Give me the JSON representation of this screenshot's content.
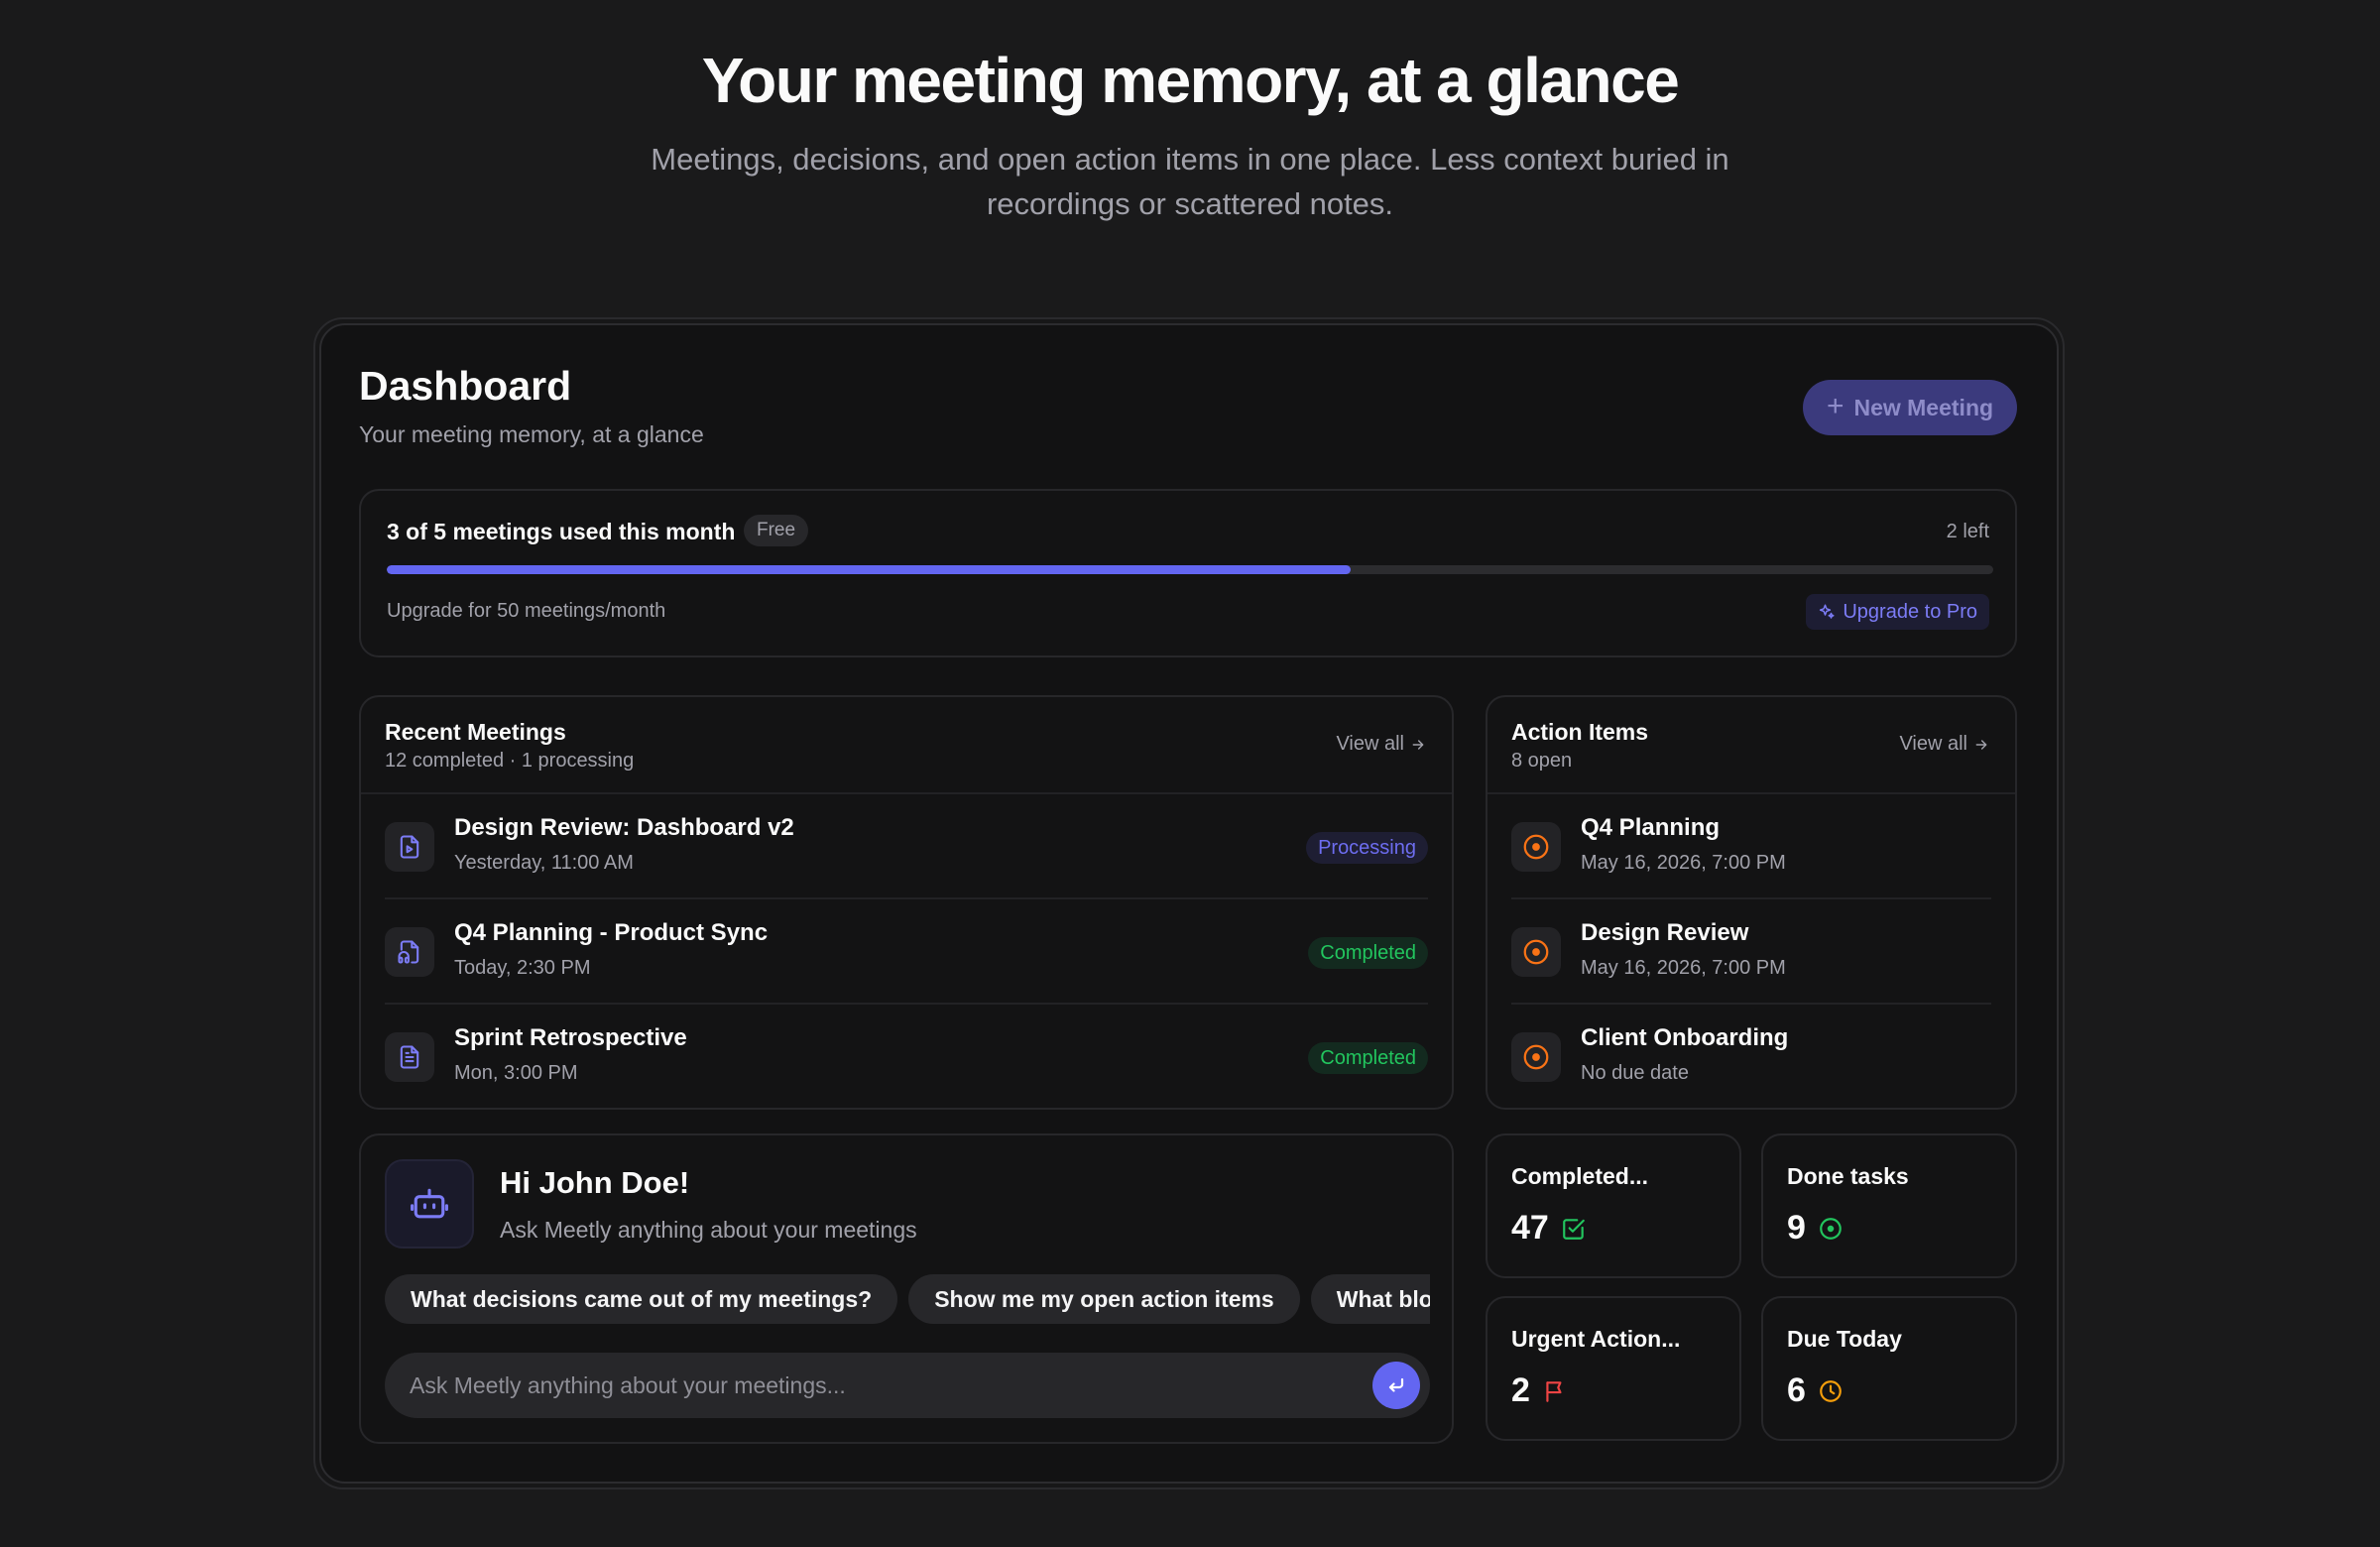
{
  "hero": {
    "title": "Your meeting memory, at a glance",
    "subtitle": "Meetings, decisions, and open action items in one place. Less context buried in recordings or scattered notes."
  },
  "dashboard": {
    "title": "Dashboard",
    "subtitle": "Your meeting memory, at a glance",
    "new_meeting_label": "New Meeting"
  },
  "usage": {
    "title": "3 of 5 meetings used this month",
    "plan_badge": "Free",
    "remaining": "2 left",
    "progress_fraction": 0.6,
    "upgrade_text": "Upgrade for 50 meetings/month",
    "upgrade_button": "Upgrade to Pro"
  },
  "recent_meetings": {
    "title": "Recent Meetings",
    "subtitle": "12 completed · 1 processing",
    "view_all": "View all",
    "items": [
      {
        "title": "Design Review: Dashboard v2",
        "date": "Yesterday, 11:00 AM",
        "status": "Processing",
        "icon": "video-file-icon"
      },
      {
        "title": "Q4 Planning - Product Sync",
        "date": "Today, 2:30 PM",
        "status": "Completed",
        "icon": "audio-file-icon"
      },
      {
        "title": "Sprint Retrospective",
        "date": "Mon, 3:00 PM",
        "status": "Completed",
        "icon": "text-file-icon"
      }
    ]
  },
  "action_items": {
    "title": "Action Items",
    "subtitle": "8 open",
    "view_all": "View all",
    "items": [
      {
        "title": "Q4 Planning",
        "date": "May 16, 2026, 7:00 PM",
        "icon": "target-icon"
      },
      {
        "title": "Design Review",
        "date": "May 16, 2026, 7:00 PM",
        "icon": "target-icon"
      },
      {
        "title": "Client Onboarding",
        "date": "No due date",
        "icon": "target-icon"
      }
    ]
  },
  "assistant": {
    "greeting": "Hi John Doe!",
    "subtitle": "Ask Meetly anything about your meetings",
    "chips": [
      "What decisions came out of my meetings?",
      "Show me my open action items",
      "What blockers came up?"
    ],
    "input_placeholder": "Ask Meetly anything about your meetings..."
  },
  "stats": [
    {
      "label": "Completed...",
      "value": "47",
      "icon": "check-square-icon",
      "color": "#22c55e"
    },
    {
      "label": "Done tasks",
      "value": "9",
      "icon": "circle-dot-icon",
      "color": "#22c55e"
    },
    {
      "label": "Urgent Action...",
      "value": "2",
      "icon": "flag-icon",
      "color": "#ef4444"
    },
    {
      "label": "Due Today",
      "value": "6",
      "icon": "clock-icon",
      "color": "#f59e0b"
    }
  ],
  "colors": {
    "accent": "#6366f1",
    "success": "#22c55e",
    "warning_orange": "#f97316",
    "danger": "#ef4444",
    "amber": "#f59e0b"
  }
}
